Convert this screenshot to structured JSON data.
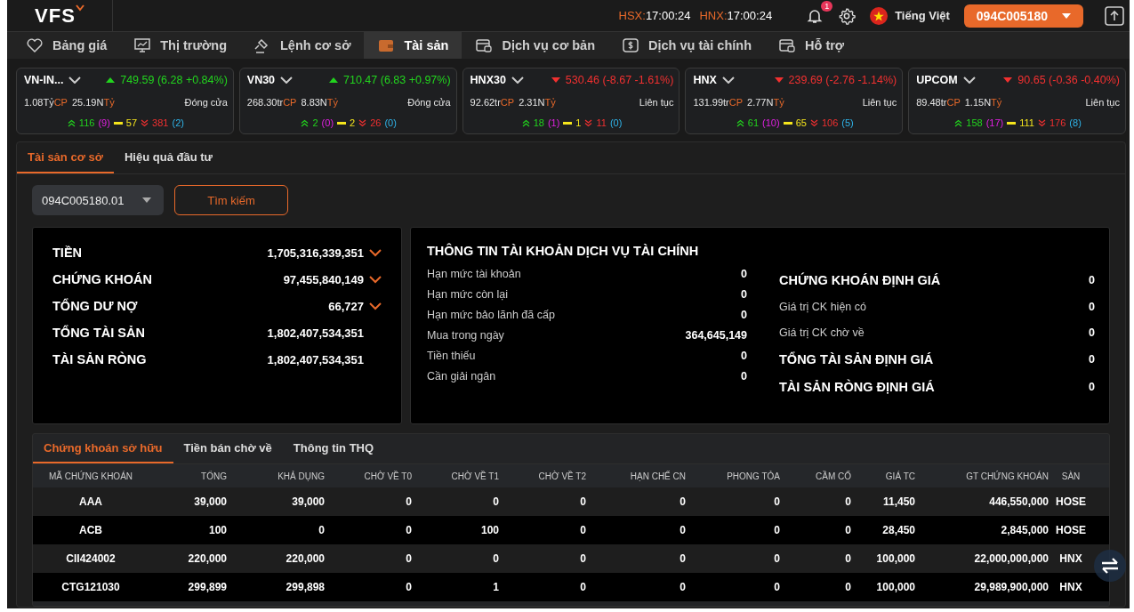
{
  "header": {
    "logo": "VFS",
    "clocks": [
      {
        "exchange": "HSX:",
        "time": "17:00:24"
      },
      {
        "exchange": "HNX:",
        "time": "17:00:24"
      }
    ],
    "notification_count": "1",
    "language": "Tiếng Việt",
    "account": "094C005180"
  },
  "nav": [
    {
      "label": "Bảng giá",
      "selected": false
    },
    {
      "label": "Thị trường",
      "selected": false
    },
    {
      "label": "Lệnh cơ sở",
      "selected": false
    },
    {
      "label": "Tài sản",
      "selected": true
    },
    {
      "label": "Dịch vụ cơ bản",
      "selected": false
    },
    {
      "label": "Dịch vụ tài chính",
      "selected": false
    },
    {
      "label": "Hỗ trợ",
      "selected": false
    }
  ],
  "indices": [
    {
      "name": "VN-IN...",
      "rising": true,
      "value": "749.59 (6.28 +0.84%)",
      "volume": "1.08Tỷ",
      "volume_unit": "CP",
      "turnover": "25.19N",
      "turnover_unit": "Tỷ",
      "session": "Đóng cửa",
      "advances": "116",
      "ceiling": "(9)",
      "unchanged": "57",
      "declines": "381",
      "floor": "(2)"
    },
    {
      "name": "VN30",
      "rising": true,
      "value": "710.47 (6.83 +0.97%)",
      "volume": "268.30tr",
      "volume_unit": "CP",
      "turnover": "8.83N",
      "turnover_unit": "Tỷ",
      "session": "Đóng cửa",
      "advances": "2",
      "ceiling": "(0)",
      "unchanged": "2",
      "declines": "26",
      "floor": "(0)"
    },
    {
      "name": "HNX30",
      "rising": false,
      "value": "530.46 (-8.67 -1.61%)",
      "volume": "92.62tr",
      "volume_unit": "CP",
      "turnover": "2.31N",
      "turnover_unit": "Tỷ",
      "session": "Liên tục",
      "advances": "18",
      "ceiling": "(1)",
      "unchanged": "1",
      "declines": "11",
      "floor": "(0)"
    },
    {
      "name": "HNX",
      "rising": false,
      "value": "239.69 (-2.76 -1.14%)",
      "volume": "131.99tr",
      "volume_unit": "CP",
      "turnover": "2.77N",
      "turnover_unit": "Tỷ",
      "session": "Liên tục",
      "advances": "61",
      "ceiling": "(10)",
      "unchanged": "65",
      "declines": "106",
      "floor": "(5)"
    },
    {
      "name": "UPCOM",
      "rising": false,
      "value": "90.65 (-0.36 -0.40%)",
      "volume": "89.48tr",
      "volume_unit": "CP",
      "turnover": "1.15N",
      "turnover_unit": "Tỷ",
      "session": "Liên tục",
      "advances": "158",
      "ceiling": "(17)",
      "unchanged": "111",
      "declines": "176",
      "floor": "(8)"
    }
  ],
  "sub_tabs": [
    {
      "label": "Tài sản cơ sở",
      "selected": true
    },
    {
      "label": "Hiệu quả đầu tư",
      "selected": false
    }
  ],
  "account_select": {
    "value": "094C005180.01"
  },
  "search_button": "Tìm kiếm",
  "summary": [
    {
      "label": "TIỀN",
      "value": "1,705,316,339,351",
      "expandable": true
    },
    {
      "label": "CHỨNG KHOÁN",
      "value": "97,455,840,149",
      "expandable": true
    },
    {
      "label": "TỔNG DƯ NỢ",
      "value": "66,727",
      "expandable": true
    },
    {
      "label": "TỔNG TÀI SẢN",
      "value": "1,802,407,534,351",
      "expandable": false
    },
    {
      "label": "TÀI SẢN RÒNG",
      "value": "1,802,407,534,351",
      "expandable": false
    }
  ],
  "financial_service": {
    "title": "THÔNG TIN TÀI KHOẢN DỊCH VỤ TÀI CHÍNH",
    "rows": [
      {
        "label": "Hạn mức tài khoản",
        "value": "0"
      },
      {
        "label": "Hạn mức còn lại",
        "value": "0"
      },
      {
        "label": "Hạn mức bảo lãnh đã cấp",
        "value": "0"
      },
      {
        "label": "Mua trong ngày",
        "value": "364,645,149"
      },
      {
        "label": "Tiền thiếu",
        "value": "0"
      },
      {
        "label": "Cần giải ngân",
        "value": "0"
      }
    ],
    "valuation": [
      {
        "kind": "heading",
        "label": "CHỨNG KHOÁN ĐỊNH GIÁ",
        "value": "0"
      },
      {
        "kind": "item",
        "label": "Giá trị CK hiện có",
        "value": "0"
      },
      {
        "kind": "item",
        "label": "Giá trị CK chờ về",
        "value": "0"
      },
      {
        "kind": "heading",
        "label": "TỔNG TÀI SẢN ĐỊNH GIÁ",
        "value": "0"
      },
      {
        "kind": "heading",
        "label": "TÀI SẢN RÒNG ĐỊNH GIÁ",
        "value": "0"
      }
    ]
  },
  "holdings": {
    "tabs": [
      {
        "label": "Chứng khoán sở hữu",
        "selected": true
      },
      {
        "label": "Tiền bán chờ về",
        "selected": false
      },
      {
        "label": "Thông tin THQ",
        "selected": false
      }
    ],
    "table": {
      "columns": [
        "MÃ CHỨNG KHOÁN",
        "TỔNG",
        "KHẢ DỤNG",
        "CHỜ VỀ T0",
        "CHỜ VỀ T1",
        "CHỜ VỀ T2",
        "HẠN CHẾ CN",
        "PHONG TỎA",
        "CẦM CỐ",
        "GIÁ TC",
        "GT CHỨNG KHOÁN",
        "SÀN"
      ],
      "rows": [
        [
          "AAA",
          "39,000",
          "39,000",
          "0",
          "0",
          "0",
          "0",
          "0",
          "0",
          "11,450",
          "446,550,000",
          "HOSE"
        ],
        [
          "ACB",
          "100",
          "0",
          "0",
          "100",
          "0",
          "0",
          "0",
          "0",
          "28,450",
          "2,845,000",
          "HOSE"
        ],
        [
          "CII424002",
          "220,000",
          "220,000",
          "0",
          "0",
          "0",
          "0",
          "0",
          "0",
          "100,000",
          "22,000,000,000",
          "HNX"
        ],
        [
          "CTG121030",
          "299,899",
          "299,898",
          "0",
          "1",
          "0",
          "0",
          "0",
          "0",
          "100,000",
          "29,989,900,000",
          "HNX"
        ]
      ]
    }
  }
}
